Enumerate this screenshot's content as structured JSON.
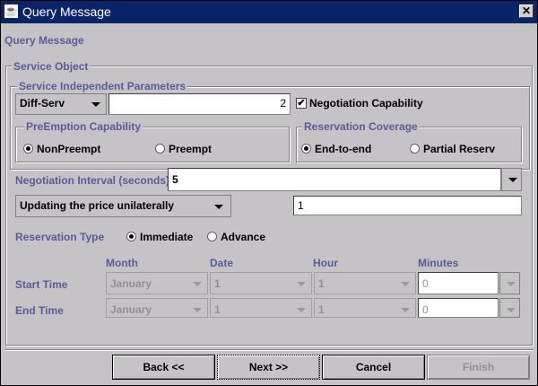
{
  "window": {
    "title": "Query Message",
    "close_glyph": "✕",
    "logo_glyph": "☕"
  },
  "form": {
    "heading": "Query Message",
    "service_object": "Service Object",
    "sip": {
      "legend": "Service Independent Parameters",
      "service_type": "Diff-Serv",
      "quantity": "2",
      "negotiation_capability": "Negotiation Capability",
      "negotiation_checked": "✔",
      "preemption": {
        "legend": "PreEmption Capability",
        "options": [
          "NonPreempt",
          "Preempt"
        ],
        "selected": "NonPreempt"
      },
      "coverage": {
        "legend": "Reservation Coverage",
        "options": [
          "End-to-end",
          "Partial Reserv"
        ],
        "selected": "End-to-end"
      }
    },
    "negotiation_interval": {
      "label": "Negotiation Interval (seconds)",
      "value": "5"
    },
    "pricing": {
      "value": "Updating the price unilaterally",
      "amount": "1"
    },
    "reservation": {
      "label": "Reservation Type",
      "options": [
        "Immediate",
        "Advance"
      ],
      "selected": "Immediate"
    },
    "time": {
      "headers": [
        "Month",
        "Date",
        "Hour",
        "Minutes"
      ],
      "start": {
        "label": "Start Time",
        "month": "January",
        "date": "1",
        "hour": "1",
        "minutes": "0"
      },
      "end": {
        "label": "End Time",
        "month": "January",
        "date": "1",
        "hour": "1",
        "minutes": "0"
      }
    }
  },
  "buttons": {
    "back": "Back <<",
    "next": "Next >>",
    "cancel": "Cancel",
    "finish": "Finish"
  }
}
